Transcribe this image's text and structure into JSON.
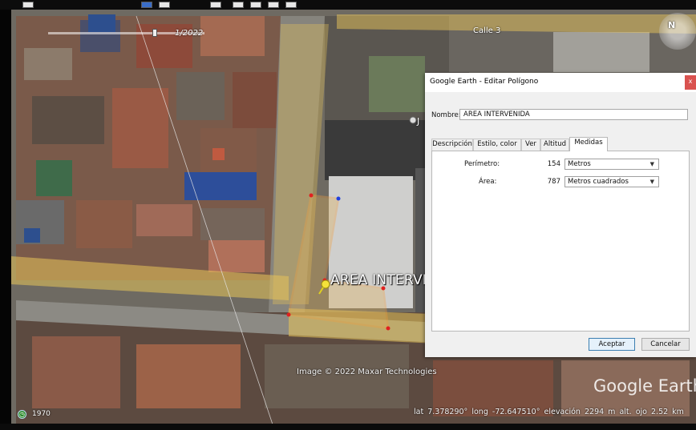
{
  "map": {
    "road_label": "Calle 3",
    "date_label": "1/2022",
    "placemark_label": "AREA INTERVENIDA",
    "imagery_credit": "Image © 2022 Maxar Technologies",
    "logo": "Google Earth",
    "history_year": "1970",
    "pin_label_partial": "J",
    "status": {
      "lat_label": "lat",
      "lat_value": "7.378290°",
      "long_label": "long",
      "long_value": "-72.647510°",
      "elev_label": "elevación",
      "elev_value": "2294 m",
      "eye_label": "alt. ojo",
      "eye_value": "2.52 km"
    }
  },
  "dialog": {
    "title": "Google Earth - Editar Polígono",
    "close": "x",
    "name_label": "Nombre:",
    "name_value": "AREA INTERVENIDA",
    "tabs": [
      "Descripción",
      "Estilo, color",
      "Ver",
      "Altitud",
      "Medidas"
    ],
    "active_tab": "Medidas",
    "measures": {
      "perimeter_label": "Perímetro:",
      "perimeter_value": "154",
      "perimeter_unit": "Metros",
      "area_label": "Área:",
      "area_value": "787",
      "area_unit": "Metros cuadrados"
    },
    "ok_label": "Aceptar",
    "cancel_label": "Cancelar"
  },
  "colors": {
    "polygon_fill": "#e2b25a",
    "polygon_stroke": "#f0a040",
    "road_overlay": "#e8c45a",
    "dialog_bg": "#f0f0f0",
    "close_button": "#d9524f"
  }
}
